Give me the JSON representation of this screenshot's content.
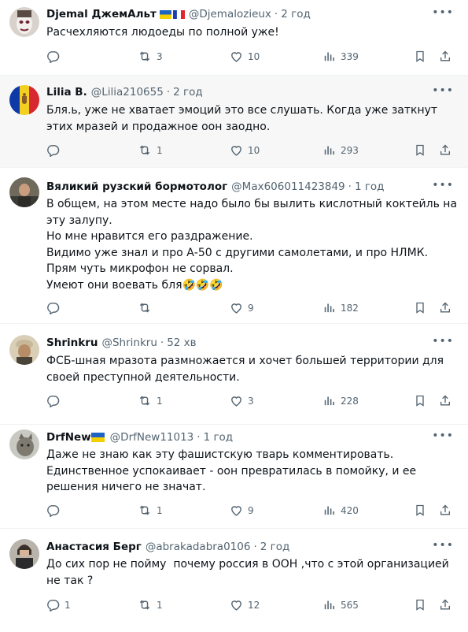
{
  "tweets": [
    {
      "name": "Djemal ДжемАльт",
      "handle": "@Djemalozieux",
      "time": "2 год",
      "flags": [
        "ukraine",
        "france"
      ],
      "text": [
        "Расчехляются людоеды по полной уже!"
      ],
      "replies": "",
      "retweets": "3",
      "likes": "10",
      "views": "339",
      "highlight": false
    },
    {
      "name": "Lilia B.",
      "handle": "@Lilia210655",
      "time": "2 год",
      "flags": [],
      "text": [
        "Бля.ь, уже не хватает эмоций это все слушать. Когда уже заткнут этих мразей и продажное оон заодно."
      ],
      "replies": "",
      "retweets": "1",
      "likes": "10",
      "views": "293",
      "highlight": true
    },
    {
      "name": "Вяликий рузский бормотолог",
      "handle": "@Max606011423849",
      "time": "1 год",
      "flags": [],
      "text": [
        "В общем, на этом месте надо было бы вылить кислотный коктейль на эту залупу.",
        "Но мне нравится его раздражение.",
        "Видимо уже знал и про А-50 с другими самолетами, и про НЛМК.",
        "Прям чуть микрофон не сорвал.",
        "Умеют они воевать бля🤣🤣🤣"
      ],
      "replies": "",
      "retweets": "",
      "likes": "9",
      "views": "182",
      "highlight": false
    },
    {
      "name": "Shrinkru",
      "handle": "@Shrinkru",
      "time": "52 хв",
      "flags": [],
      "text": [
        "ФСБ-шная мразота размножается и хочет большей территории для своей преступной деятельности."
      ],
      "replies": "",
      "retweets": "1",
      "likes": "3",
      "views": "228",
      "highlight": false
    },
    {
      "name": "DrfNew",
      "handle": "@DrfNew11013",
      "time": "1 год",
      "flags": [
        "ukraine"
      ],
      "text": [
        "Даже не знаю как эту фашистскую тварь комментировать. Единственное успокаивает - оон превратилась в помойку, и ее решения ничего не значат."
      ],
      "replies": "",
      "retweets": "1",
      "likes": "9",
      "views": "420",
      "highlight": false
    },
    {
      "name": "Анастасия Берг",
      "handle": "@abrakadabra0106",
      "time": "2 год",
      "flags": [],
      "text": [
        "До сих пор не пойму  почему россия в ООН ,что с этой организацией не так ?"
      ],
      "replies": "1",
      "retweets": "1",
      "likes": "12",
      "views": "565",
      "highlight": false
    }
  ],
  "colors": {
    "text": "#0f1419",
    "secondary": "#536471",
    "divider": "#eff3f4"
  },
  "icons": [
    "reply-icon",
    "retweet-icon",
    "like-icon",
    "views-icon",
    "bookmark-icon",
    "share-icon",
    "more-icon"
  ]
}
